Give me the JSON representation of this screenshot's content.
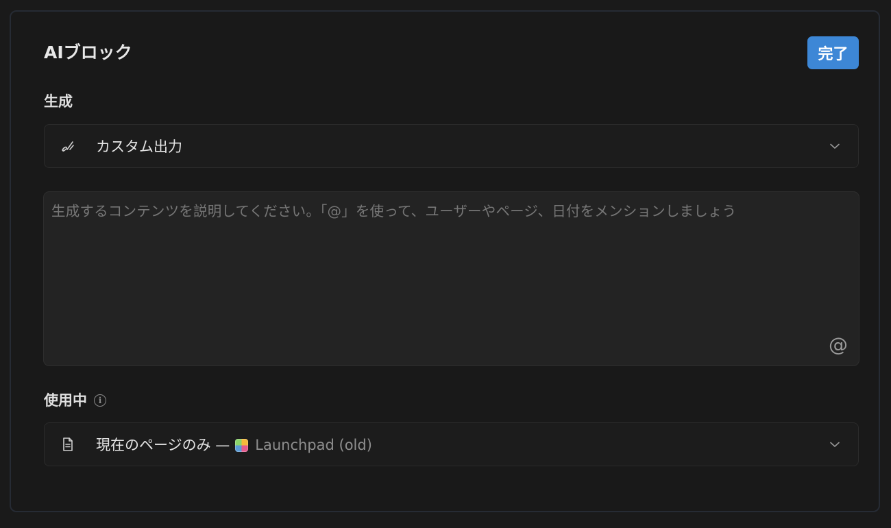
{
  "panel": {
    "title": "AIブロック",
    "done_label": "完了"
  },
  "generate": {
    "label": "生成",
    "icon": "custom-output-icon",
    "selected": "カスタム出力"
  },
  "prompt": {
    "placeholder": "生成するコンテンツを説明してください。「@」を使って、ユーザーやページ、日付をメンションしましょう",
    "mention_symbol": "@"
  },
  "using": {
    "label": "使用中",
    "icon": "page-icon",
    "scope": "現在のページのみ —",
    "page_name": "Launchpad (old)"
  },
  "colors": {
    "accent": "#3d87d6",
    "background": "#191919"
  }
}
